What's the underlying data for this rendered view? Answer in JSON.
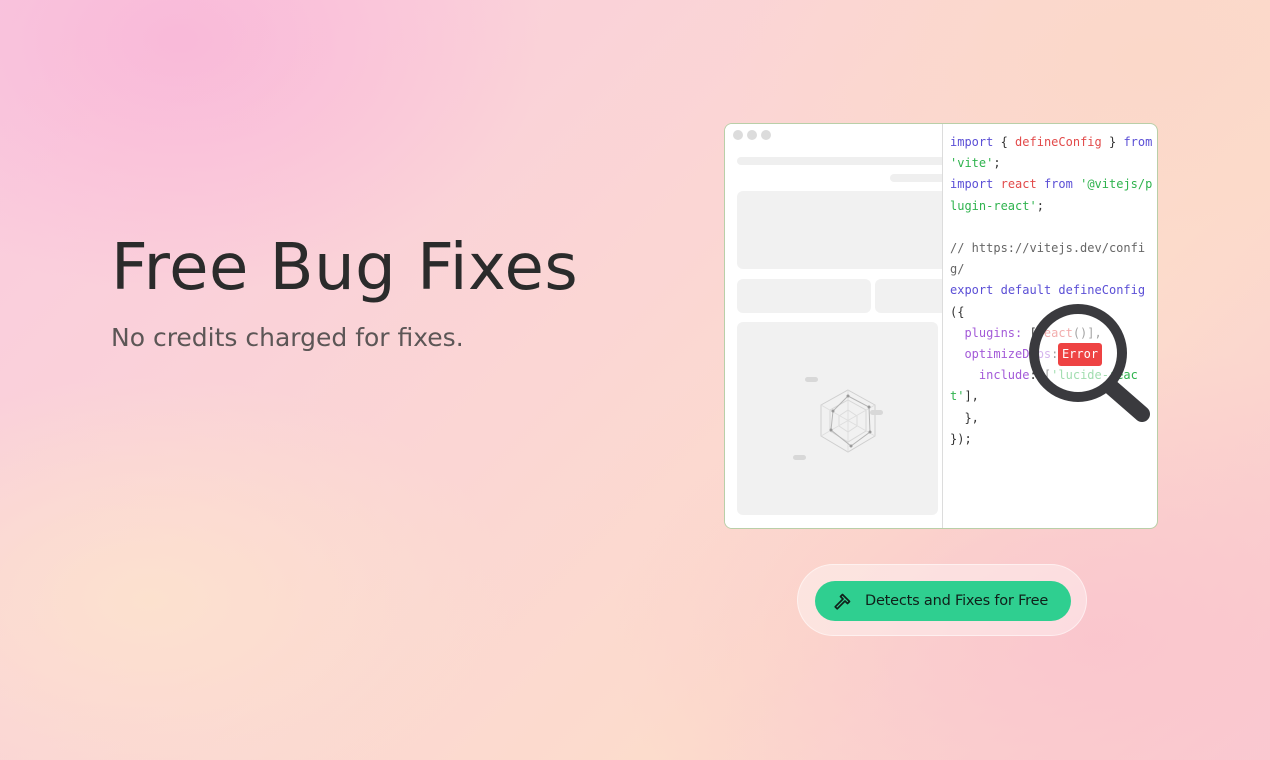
{
  "hero": {
    "title": "Free Bug Fixes",
    "subtitle": "No credits charged for fixes."
  },
  "code_lines": [
    [
      [
        "kw",
        "import"
      ],
      [
        "pun",
        " { "
      ],
      [
        "fn",
        "defineConfig"
      ],
      [
        "pun",
        " } "
      ],
      [
        "kw",
        "from"
      ],
      [
        "pun",
        " "
      ],
      [
        "str",
        "'vite'"
      ],
      [
        "pun",
        ";"
      ]
    ],
    [
      [
        "kw",
        "import"
      ],
      [
        "pun",
        " "
      ],
      [
        "fn",
        "react"
      ],
      [
        "pun",
        " "
      ],
      [
        "kw",
        "from"
      ],
      [
        "pun",
        " "
      ],
      [
        "str",
        "'@vitejs/plugin-react'"
      ],
      [
        "pun",
        ";"
      ]
    ],
    [
      [
        "pun",
        " "
      ]
    ],
    [
      [
        "cm",
        "// https://vitejs.dev/config/"
      ]
    ],
    [
      [
        "kw",
        "export"
      ],
      [
        "pun",
        " "
      ],
      [
        "kw",
        "default"
      ],
      [
        "pun",
        " "
      ],
      [
        "kw",
        "defineConfig"
      ],
      [
        "pun",
        "({"
      ]
    ],
    [
      [
        "pun",
        "  "
      ],
      [
        "prop",
        "plugins:"
      ],
      [
        "pun",
        " ["
      ],
      [
        "fn",
        "react"
      ],
      [
        "pun",
        "()],"
      ]
    ],
    [
      [
        "pun",
        "  "
      ],
      [
        "prop",
        "optimizeDeps"
      ],
      [
        "pun",
        ": {"
      ]
    ],
    [
      [
        "pun",
        "    "
      ],
      [
        "prop",
        "include"
      ],
      [
        "pun",
        ": ["
      ],
      [
        "str",
        "'lucide-react'"
      ],
      [
        "pun",
        "],"
      ]
    ],
    [
      [
        "pun",
        "  },"
      ]
    ],
    [
      [
        "pun",
        "});"
      ]
    ]
  ],
  "error_badge": "Error",
  "cta": {
    "label": "Detects and Fixes for Free",
    "icon": "hammer-icon",
    "color": "#2fcf90"
  }
}
